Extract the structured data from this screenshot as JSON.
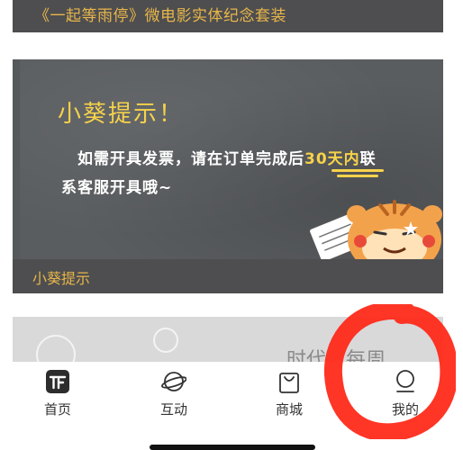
{
  "top_card": {
    "title": "《一起等雨停》微电影实体纪念套装"
  },
  "notice_card": {
    "heading": "小葵提示！",
    "line1_prefix": "如需开具发票，请在订单完成后",
    "line1_highlight": "30天内",
    "line1_suffix": "联",
    "line2": "系客服开具哦~",
    "footer_label": "小葵提示"
  },
  "bottom_card": {
    "partial_text": "时代…每周"
  },
  "tabbar": {
    "items": [
      {
        "label": "首页",
        "icon": "home-logo-icon",
        "active": true
      },
      {
        "label": "互动",
        "icon": "planet-icon",
        "active": false
      },
      {
        "label": "商城",
        "icon": "shopping-bag-icon",
        "active": false
      },
      {
        "label": "我的",
        "icon": "user-profile-icon",
        "active": false
      }
    ]
  },
  "colors": {
    "card_header_bg": "#4e4e50",
    "accent_gold": "#e8b64a",
    "chalk_yellow": "#f7d24a",
    "annotation_red": "#ff2a1a"
  }
}
